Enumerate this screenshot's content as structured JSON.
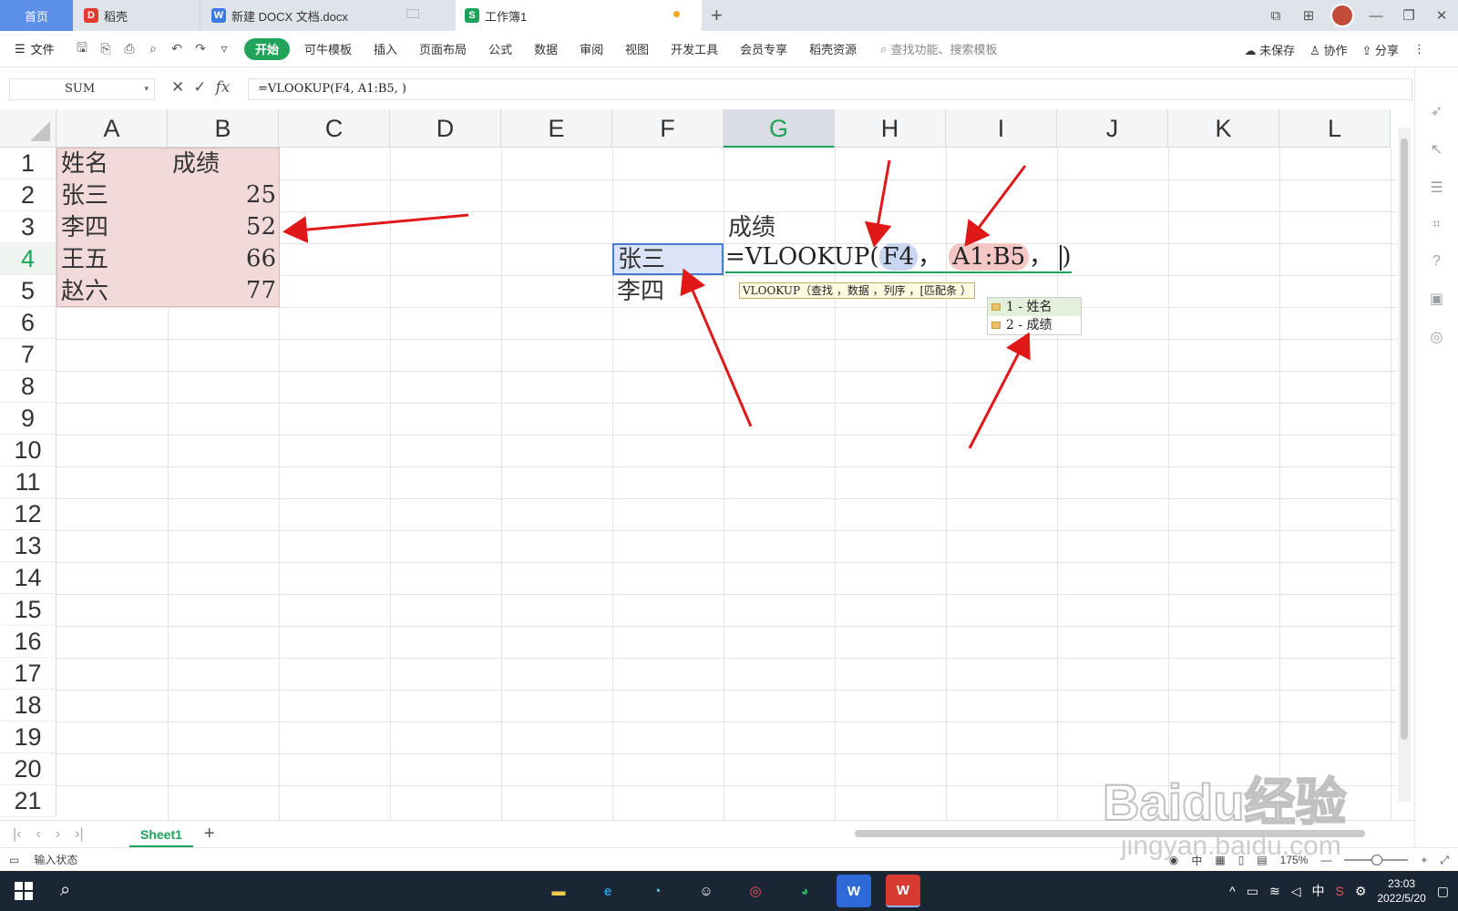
{
  "tabs": {
    "home": "首页",
    "daoke": "稻壳",
    "docx": "新建 DOCX 文档.docx",
    "workbook": "工作簿1"
  },
  "menu": {
    "file": "文件",
    "items": [
      "开始",
      "可牛模板",
      "插入",
      "页面布局",
      "公式",
      "数据",
      "审阅",
      "视图",
      "开发工具",
      "会员专享",
      "稻壳资源"
    ],
    "search_placeholder": "查找功能、搜索模板",
    "unsaved": "未保存",
    "collab": "协作",
    "share": "分享"
  },
  "formula_bar": {
    "name_box": "SUM",
    "formula": "=VLOOKUP(F4, A1:B5, )"
  },
  "columns": [
    "A",
    "B",
    "C",
    "D",
    "E",
    "F",
    "G",
    "H",
    "I",
    "J",
    "K",
    "L"
  ],
  "rows": [
    "1",
    "2",
    "3",
    "4",
    "5",
    "6",
    "7",
    "8",
    "9",
    "10",
    "11",
    "12",
    "13",
    "14",
    "15",
    "16",
    "17",
    "18",
    "19",
    "20",
    "21"
  ],
  "cells": {
    "A1": "姓名",
    "B1": "成绩",
    "A2": "张三",
    "B2": "25",
    "A3": "李四",
    "B3": "52",
    "A4": "王五",
    "B4": "66",
    "A5": "赵六",
    "B5": "77",
    "G3": "成绩",
    "F4": "张三",
    "F5": "李四"
  },
  "edit_cell": {
    "prefix": "=VLOOKUP(",
    "ref1": "F4",
    "sep1": "，",
    "ref2": "A1:B5",
    "sep2": "，",
    "suffix": ")"
  },
  "tooltip": "VLOOKUP（查找 ，数据 ，列序 ，[匹配条 ）",
  "autocomplete": [
    "1 - 姓名",
    "2 - 成绩"
  ],
  "sheet_tab": "Sheet1",
  "status": {
    "mode": "输入状态",
    "zoom": "175%",
    "input_method": "中"
  },
  "taskbar": {
    "time": "23:03",
    "date": "2022/5/20",
    "ime": "中"
  },
  "watermark": {
    "brand": "Baidu经验",
    "url": "jingyan.baidu.com"
  },
  "colors": {
    "accent_green": "#1da35b",
    "arrow_red": "#e01818",
    "range_pink": "#f3dada"
  }
}
